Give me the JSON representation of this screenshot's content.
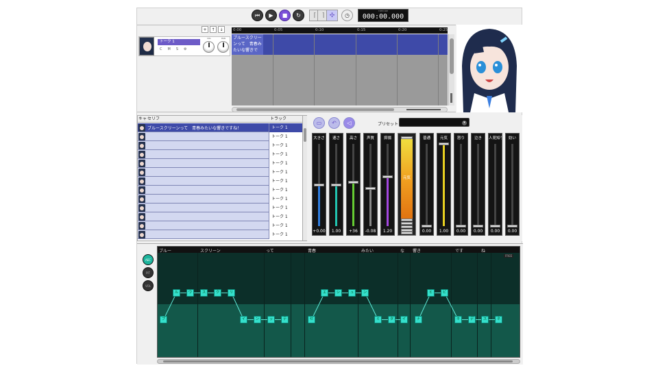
{
  "toolbar": {
    "counter_caption": "TIMECODE",
    "counter_value": "000:00.000"
  },
  "timeline": {
    "ruler_ticks": [
      "0:00",
      "0:05",
      "0:10",
      "0:15",
      "0:20",
      "0:25"
    ],
    "track_name": "トーク 1",
    "track_mini_labels": [
      "C",
      "M",
      "S",
      "⚙"
    ],
    "knob_labels": [
      "VOL",
      "PAN"
    ],
    "clip_text": "ブルースクリーンって　青春みたいな響きで"
  },
  "list": {
    "headers": [
      "キャ",
      "セリフ",
      "トラック"
    ],
    "rows": [
      {
        "text": "ブルースクリーンって　青春みたいな響きですね！",
        "track": "トーク 1",
        "selected": true
      },
      {
        "text": "",
        "track": "トーク 1"
      },
      {
        "text": "",
        "track": "トーク 1"
      },
      {
        "text": "",
        "track": "トーク 1"
      },
      {
        "text": "",
        "track": "トーク 1"
      },
      {
        "text": "",
        "track": "トーク 1"
      },
      {
        "text": "",
        "track": "トーク 1"
      },
      {
        "text": "",
        "track": "トーク 1"
      },
      {
        "text": "",
        "track": "トーク 1"
      },
      {
        "text": "",
        "track": "トーク 1"
      },
      {
        "text": "",
        "track": "トーク 1"
      },
      {
        "text": "",
        "track": "トーク 1"
      },
      {
        "text": "",
        "track": "トーク 1"
      }
    ]
  },
  "voice": {
    "preset_label": "プリセット",
    "sliders": [
      {
        "label": "大きさ",
        "value": "+0.00",
        "level": 0.5,
        "color": "#2f7de0"
      },
      {
        "label": "速さ",
        "value": "1.00",
        "level": 0.5,
        "color": "#22c4b0"
      },
      {
        "label": "高さ",
        "value": "+36",
        "level": 0.53,
        "color": "#66cc33"
      },
      {
        "label": "声質",
        "value": "-0.08",
        "level": 0.46,
        "color": "#888888"
      },
      {
        "label": "抑揚",
        "value": "1.20",
        "level": 0.6,
        "color": "#a347e0"
      }
    ],
    "emotion_main_label": "元気",
    "emotions": [
      {
        "label": "普通",
        "value": "0.00",
        "level": 0.0,
        "color": "#777777"
      },
      {
        "label": "元気",
        "value": "1.00",
        "level": 1.0,
        "color": "#e8d020"
      },
      {
        "label": "怒り",
        "value": "0.00",
        "level": 0.0,
        "color": "#777777"
      },
      {
        "label": "泣き",
        "value": "0.00",
        "level": 0.0,
        "color": "#777777"
      },
      {
        "label": "人見知り",
        "value": "0.00",
        "level": 0.0,
        "color": "#777777"
      },
      {
        "label": "妨い",
        "value": "0.00",
        "level": 0.0,
        "color": "#777777"
      }
    ]
  },
  "pitch": {
    "side_buttons": [
      "AEC",
      "PIT",
      "VOL"
    ],
    "free_label": "FREE",
    "words": [
      "ブルー",
      "スクリーン",
      "って",
      "青春",
      "みたい",
      "な",
      "響き",
      "です",
      "ね"
    ],
    "nodes": [
      "ブ",
      "ル",
      "ウ",
      "ス",
      "ク",
      "リ",
      "イ",
      "ン",
      "ッ",
      "テ",
      "セ",
      "エ",
      "シ",
      "ュ",
      "ン",
      "ミ",
      "タ",
      "イ",
      "ナ",
      "ヒ",
      "ビ",
      "キ",
      "デ",
      "ス",
      "ネ"
    ]
  }
}
